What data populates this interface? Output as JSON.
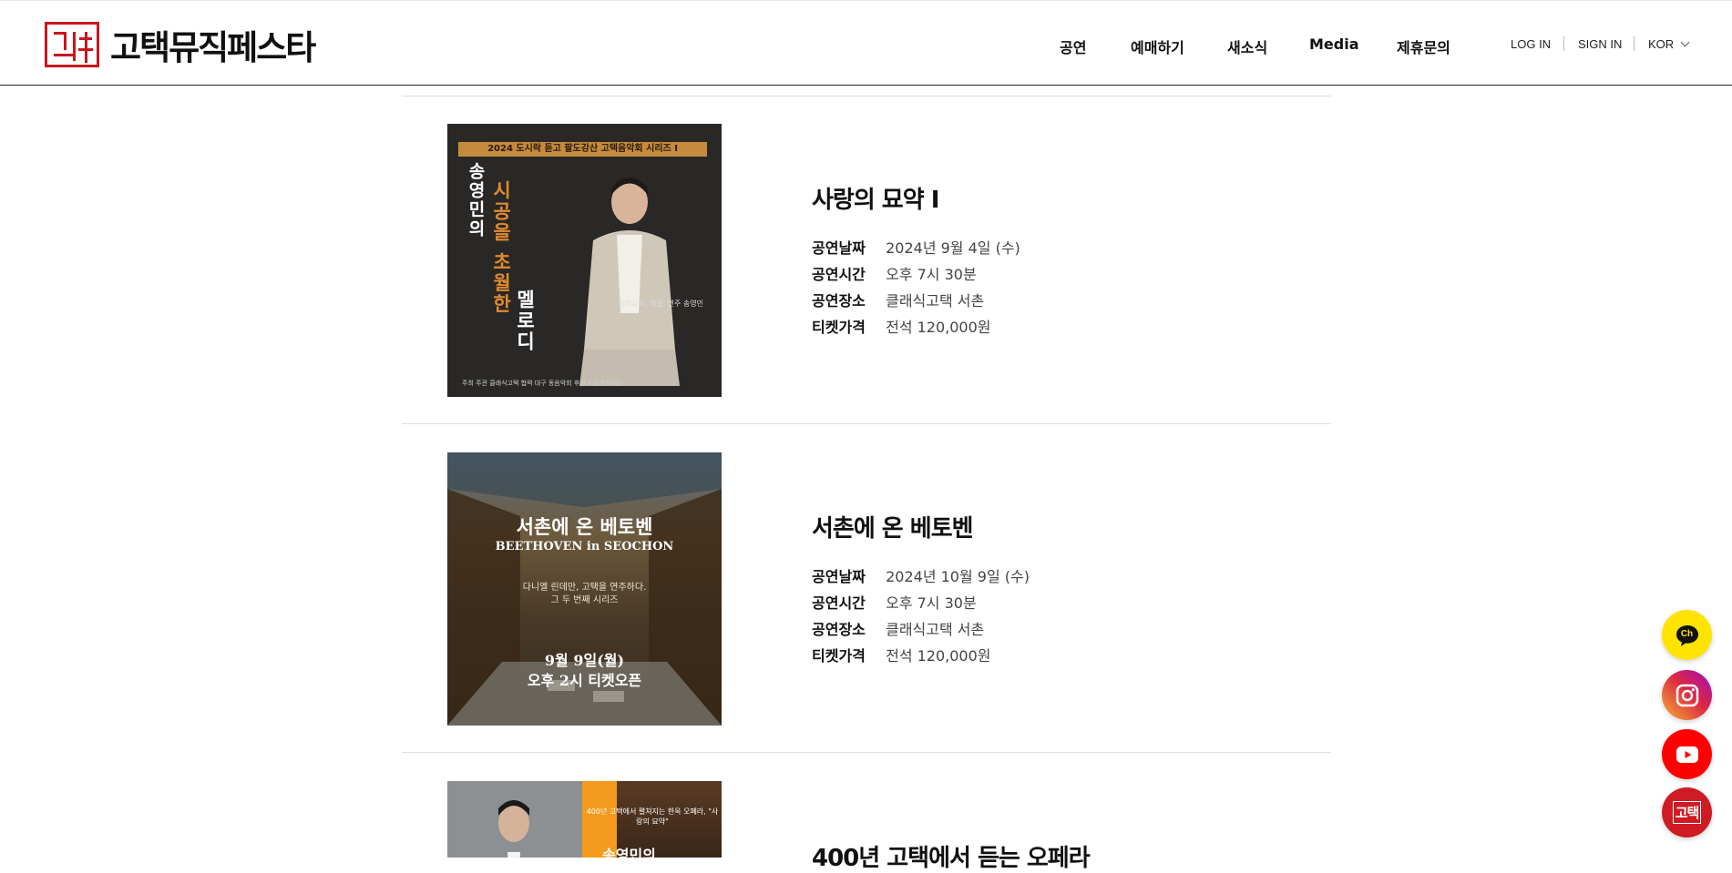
{
  "header": {
    "logo_text": "고택뮤직페스타",
    "nav": [
      "공연",
      "예매하기",
      "새소식",
      "Media",
      "제휴문의"
    ],
    "util": {
      "login": "LOG IN",
      "signin": "SIGN IN",
      "lang": "KOR"
    }
  },
  "labels": {
    "date": "공연날짜",
    "time": "공연시간",
    "venue": "공연장소",
    "price": "티켓가격"
  },
  "performances": [
    {
      "title": "사랑의 묘약 I",
      "date": "2024년 9월 4일 (수)",
      "time": "오후 7시 30분",
      "venue": "클래식고택 서촌",
      "price": "전석 120,000원",
      "poster": {
        "band": "2024 도시락 듣고 팔도강산 고택음악회 시리즈 I",
        "v1": "송영민의",
        "v2": "시공을 초월한",
        "v3": "멜로디",
        "credit": "음악감독, 해설, 연주 송영민",
        "foot": "주최 주관   클래식고택   협력   대구 동음악회   후원   서울문화재단"
      }
    },
    {
      "title": "서촌에 온 베토벤",
      "date": "2024년 10월 9일 (수)",
      "time": "오후 7시 30분",
      "venue": "클래식고택 서촌",
      "price": "전석 120,000원",
      "poster": {
        "t1": "서촌에 온 베토벤",
        "t2": "BEETHOVEN in SEOCHON",
        "t3a": "다니엘 린데만, 고택을 연주하다.",
        "t3b": "그 두 번째 시리즈",
        "t4a": "9월 9일(월)",
        "t4b": "오후 2시 티켓오픈"
      }
    },
    {
      "title": "400년 고택에서 듣는 오페라",
      "poster": {
        "txt": "400년 고택에서 펼쳐지는 한옥 오페라, \"사랑의 묘약\"",
        "big": "송영민의"
      }
    }
  ],
  "fab": {
    "kakao": "Ch",
    "home": "고택"
  }
}
